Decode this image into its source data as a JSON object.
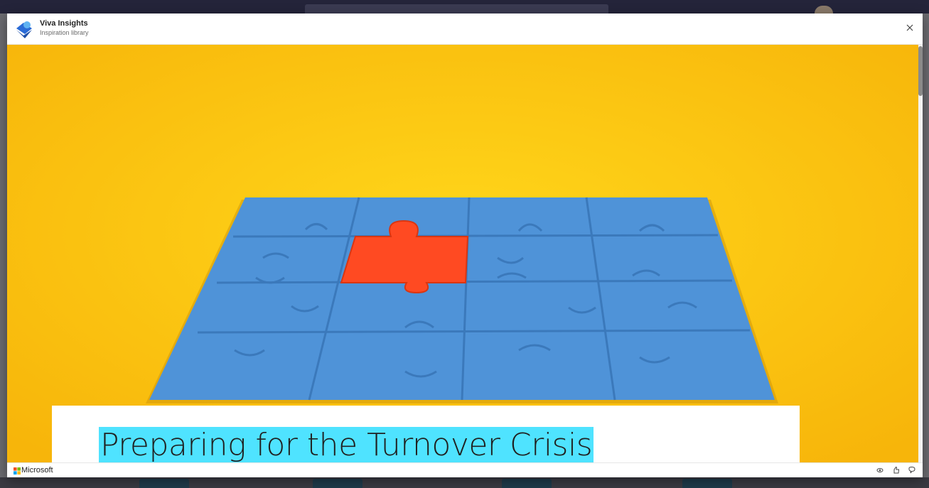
{
  "dialog": {
    "app_title": "Viva Insights",
    "app_subtitle": "Inspiration library"
  },
  "article": {
    "title": "Preparing for the Turnover Crisis",
    "title_highlight_color": "#4fe3ff",
    "hero_background_color": "#fdc70b",
    "puzzle_color": "#4f93d8",
    "puzzle_accent_color": "#ff4a22"
  },
  "footer": {
    "brand": "Microsoft",
    "icons": [
      "view-icon",
      "like-icon",
      "feedback-icon"
    ]
  },
  "icons": {
    "close": "close-icon"
  }
}
